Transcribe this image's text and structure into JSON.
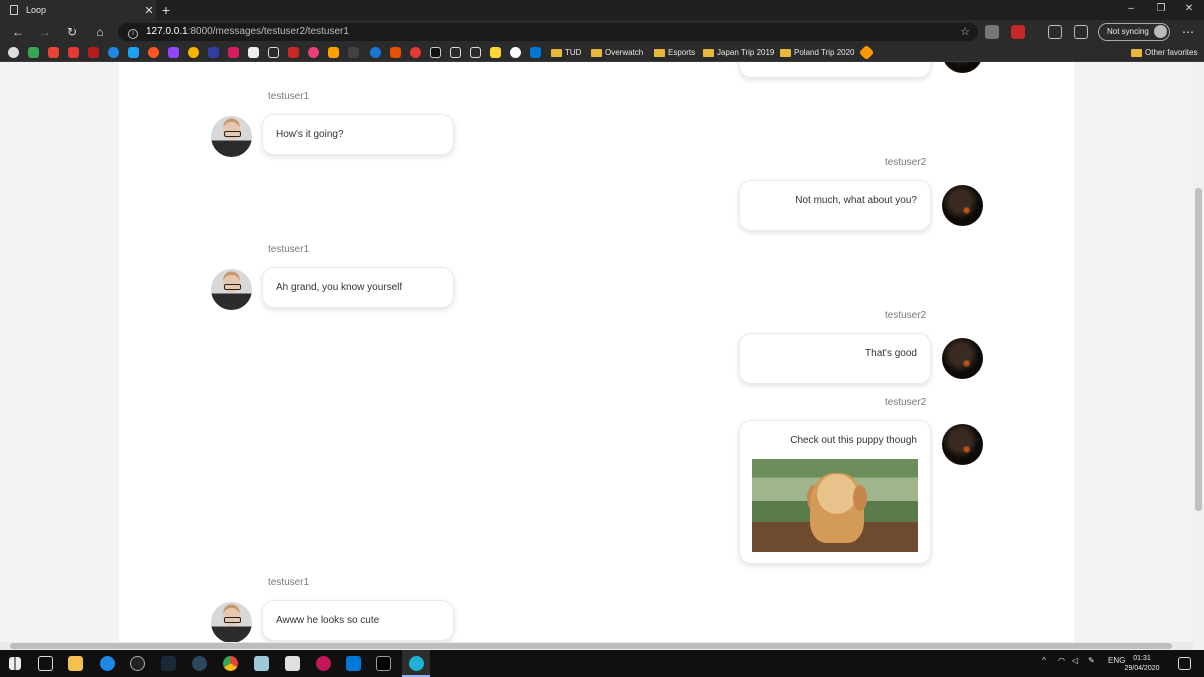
{
  "browser": {
    "tab_title": "Loop",
    "new_tab_symbol": "+",
    "tab_close_symbol": "✕",
    "url_host": "127.0.0.1",
    "url_rest": ":8000/messages/testuser2/testuser1",
    "sync_label": "Not syncing",
    "window_controls": [
      "–",
      "❐",
      "✕"
    ]
  },
  "bookmarks": {
    "folders": [
      "TUD",
      "Overwatch",
      "Esports",
      "Japan Trip 2019",
      "Poland Trip 2020"
    ],
    "other_label": "Other favorites"
  },
  "chat": {
    "messages": [
      {
        "user": "testuser1",
        "side": "left",
        "text": "How's it going?"
      },
      {
        "user": "testuser2",
        "side": "right",
        "text": "Not much, what about you?"
      },
      {
        "user": "testuser1",
        "side": "left",
        "text": "Ah grand, you know yourself"
      },
      {
        "user": "testuser2",
        "side": "right",
        "text": "That's good"
      },
      {
        "user": "testuser2",
        "side": "right",
        "text": "Check out this puppy though"
      },
      {
        "user": "testuser1",
        "side": "left",
        "text": "Awww he looks so cute"
      }
    ]
  },
  "taskbar": {
    "language": "ENG",
    "time": "01:31",
    "date": "29/04/2020"
  }
}
